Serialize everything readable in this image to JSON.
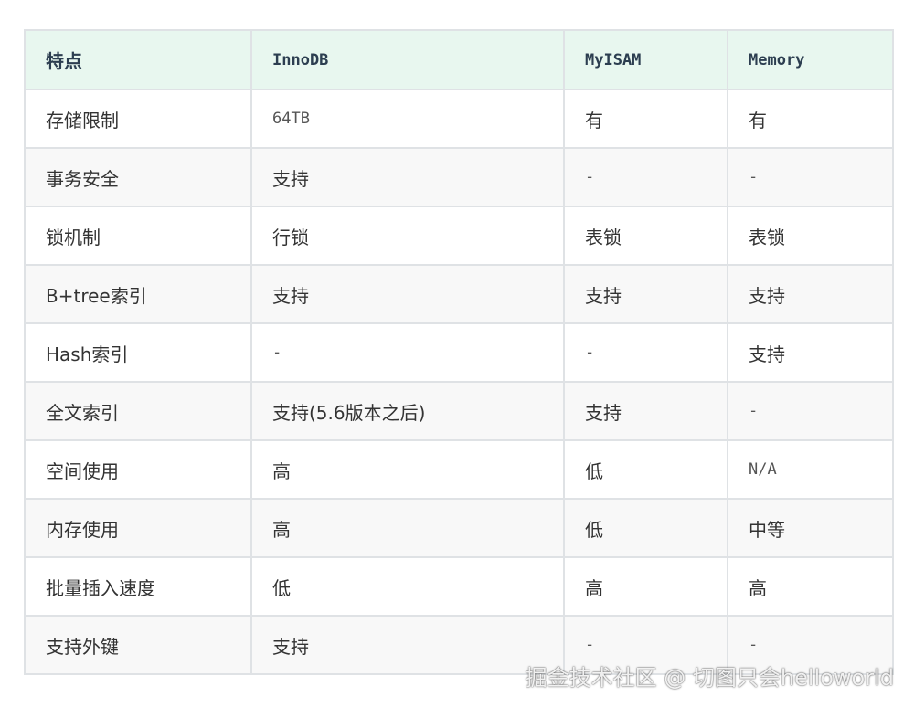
{
  "table": {
    "headers": [
      "特点",
      "InnoDB",
      "MyISAM",
      "Memory"
    ],
    "rows": [
      [
        "存储限制",
        "64TB",
        "有",
        "有"
      ],
      [
        "事务安全",
        "支持",
        "-",
        "-"
      ],
      [
        "锁机制",
        "行锁",
        "表锁",
        "表锁"
      ],
      [
        "B+tree索引",
        "支持",
        "支持",
        "支持"
      ],
      [
        "Hash索引",
        "-",
        "-",
        "支持"
      ],
      [
        "全文索引",
        "支持(5.6版本之后)",
        "支持",
        "-"
      ],
      [
        "空间使用",
        "高",
        "低",
        "N/A"
      ],
      [
        "内存使用",
        "高",
        "低",
        "中等"
      ],
      [
        "批量插入速度",
        "低",
        "高",
        "高"
      ],
      [
        "支持外键",
        "支持",
        "-",
        "-"
      ]
    ]
  },
  "watermark": {
    "text": "掘金技术社区 @ 切图只会helloworld"
  }
}
